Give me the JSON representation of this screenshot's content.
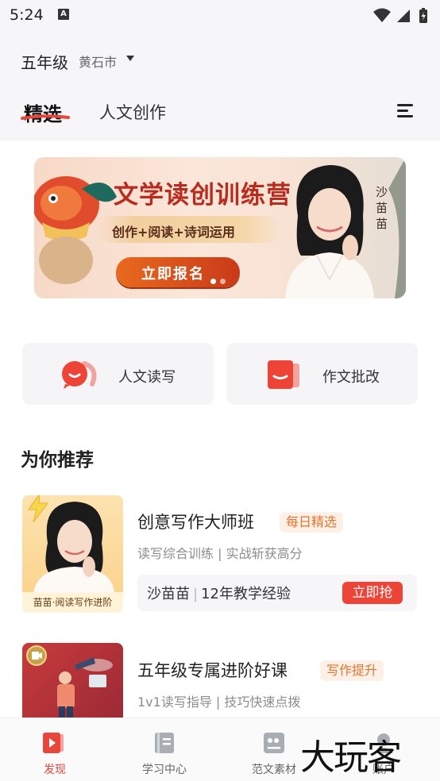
{
  "status_bar": {
    "time": "5:24",
    "notif_letter": "A"
  },
  "header": {
    "grade": "五年级",
    "city": "黄石市"
  },
  "tabs": [
    {
      "label": "精选"
    },
    {
      "label": "人文创作"
    }
  ],
  "banner": {
    "title": "文学读创训练营",
    "subtitle": "创作+阅读+诗词运用",
    "button": "立即报名",
    "teacher": "沙苗苗"
  },
  "quick_entries": [
    {
      "label": "人文读写"
    },
    {
      "label": "作文批改"
    }
  ],
  "recommend": {
    "title": "为你推荐",
    "courses": [
      {
        "title": "创意写作大师班",
        "badge": "每日精选",
        "desc": "读写综合训练 | 实战斩获高分",
        "teacher": "沙苗苗",
        "experience": "12年教学经验",
        "button": "立即抢",
        "thumb_caption": "苗苗·阅读写作进阶"
      },
      {
        "title": "五年级专属进阶好课",
        "badge": "写作提升",
        "desc": "1v1读写指导 | 技巧快速点拨"
      }
    ]
  },
  "bottom_nav": [
    {
      "label": "发现",
      "active": true
    },
    {
      "label": "学习中心"
    },
    {
      "label": "范文素材"
    },
    {
      "label": "账户"
    }
  ],
  "watermark": "大玩客",
  "colors": {
    "accent": "#e8453c",
    "badge_text": "#e2752f",
    "banner_title": "#b82c1f"
  }
}
